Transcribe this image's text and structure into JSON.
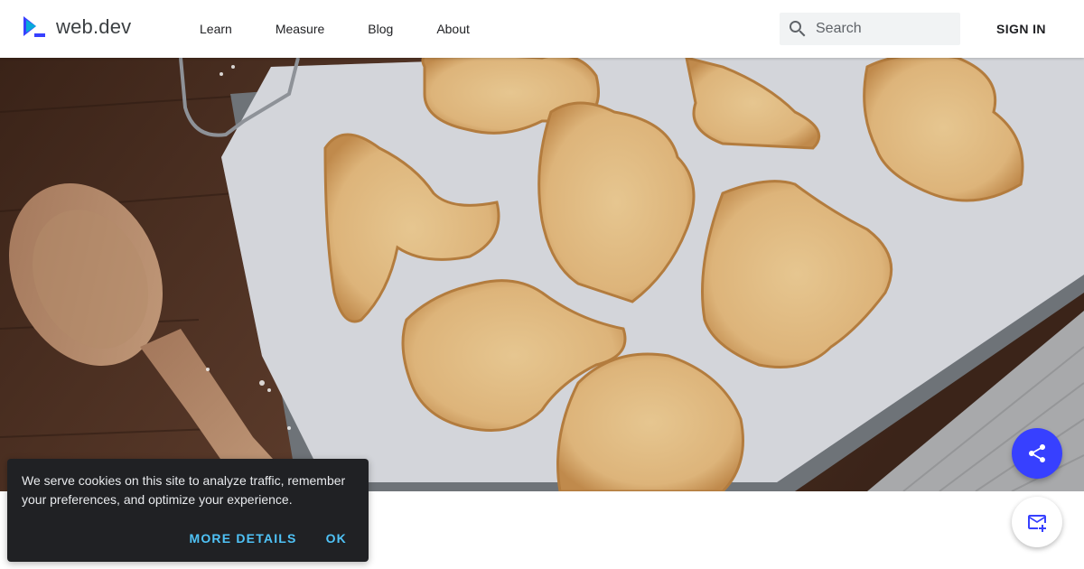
{
  "header": {
    "logo_text": "web.dev",
    "nav": [
      "Learn",
      "Measure",
      "Blog",
      "About"
    ],
    "search_placeholder": "Search",
    "signin_label": "SIGN IN"
  },
  "hero": {
    "image": "baking-tray-with-halloween-cookies"
  },
  "cookie_banner": {
    "message": "We serve cookies on this site to analyze traffic, remember your preferences, and optimize your experience.",
    "details_label": "MORE DETAILS",
    "ok_label": "OK"
  },
  "fabs": {
    "share_icon": "share-icon",
    "subscribe_icon": "mail-add-icon"
  },
  "colors": {
    "accent": "#3740ff",
    "cookie_bg": "#202124",
    "cookie_button": "#4fc3f7"
  }
}
